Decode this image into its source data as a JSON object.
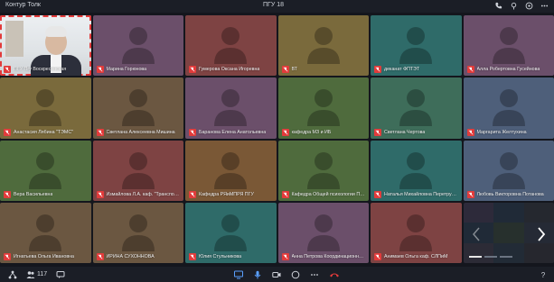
{
  "window": {
    "title": "Контур Толк",
    "meeting_title": "ПГУ 18"
  },
  "colors": {
    "accent_red": "#e23b3b",
    "background": "#14161d"
  },
  "top_icons": [
    "phone-icon",
    "pin-icon",
    "settings-icon",
    "more-icon"
  ],
  "participants": [
    {
      "name": "ПГУ Пгу Воскресенская",
      "video": true,
      "active": true
    },
    {
      "name": "Марина Горюнова",
      "color": "#6b4f6a"
    },
    {
      "name": "Гумерова Оксана Игоревна",
      "color": "#7e4343"
    },
    {
      "name": "ВТ",
      "color": "#7a6a3c"
    },
    {
      "name": "деканат ФПТЭТ",
      "color": "#2f6b69"
    },
    {
      "name": "Алла Робертовна Гусейнова",
      "color": "#6b4f6a"
    },
    {
      "name": "Анастасия Лябина \"ТЭМС\"",
      "color": "#7a6a3c"
    },
    {
      "name": "Светлана Алексеевна Мишина",
      "color": "#6b5741"
    },
    {
      "name": "Баранова Елена Анатольевна",
      "color": "#6b4f6a"
    },
    {
      "name": "кафедра МЗ и ИБ",
      "color": "#4f6b3d"
    },
    {
      "name": "Светлана Чертова",
      "color": "#3e6d5a"
    },
    {
      "name": "Маргарита Желтухина",
      "color": "#4e5f7a"
    },
    {
      "name": "Вера Васильевна",
      "color": "#4f6b3d"
    },
    {
      "name": "Измайлова Л.А. каф. \"Транспортные...\"",
      "color": "#7e4343"
    },
    {
      "name": "Кафедра РЯиМПРЯ ПГУ",
      "color": "#7a5836"
    },
    {
      "name": "Кафедра Общей психологии ПГУ",
      "color": "#4f6b3d"
    },
    {
      "name": "Наталья Михайловна Перетрухина",
      "color": "#2f6b69"
    },
    {
      "name": "Любовь Викторовна Потанова",
      "color": "#4e5f7a"
    },
    {
      "name": "Игнатьева Ольга Ивановна",
      "color": "#6b5741"
    },
    {
      "name": "ИРИНА СУХОННОВА",
      "color": "#6b5741"
    },
    {
      "name": "Юлия Стульникова",
      "color": "#2f6b69"
    },
    {
      "name": "Анна Петрова Координационный...",
      "color": "#6b4f6a"
    },
    {
      "name": "Анимаев Ольга каф. СЛПиМ",
      "color": "#7e4343"
    },
    {
      "carousel": true
    }
  ],
  "carousel_colors": [
    "#3a2f44",
    "#22303e",
    "#2b2b30",
    "#22303e",
    "#2f3a2c",
    "#2b2f3a",
    "#38323c",
    "#26323d",
    "#2e2a2e"
  ],
  "carousel": {
    "pages": 3,
    "current": 1
  },
  "bottom": {
    "participant_count": "117"
  }
}
